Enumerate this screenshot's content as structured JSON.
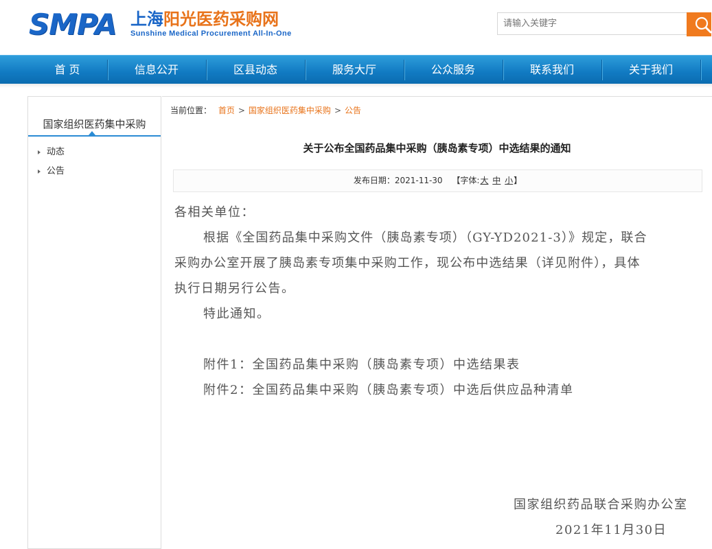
{
  "header": {
    "logo_abbr": "SMPA",
    "logo_cn_part1": "上海",
    "logo_cn_part2": "阳光医药采购网",
    "logo_en": "Sunshine Medical Procurement All-In-One",
    "search_placeholder": "请输入关键字",
    "search_icon": "search-icon"
  },
  "nav": {
    "items": [
      "首 页",
      "信息公开",
      "区县动态",
      "服务大厅",
      "公众服务",
      "联系我们",
      "关于我们"
    ]
  },
  "sidebar": {
    "title": "国家组织医药集中采购",
    "items": [
      "动态",
      "公告"
    ]
  },
  "breadcrumb": {
    "prefix": "当前位置：",
    "items": [
      "首页",
      "国家组织医药集中采购",
      "公告"
    ],
    "separator": ">"
  },
  "article": {
    "title": "关于公布全国药品集中采购（胰岛素专项）中选结果的通知",
    "publish_label": "发布日期：",
    "publish_date": "2021-11-30",
    "font_size_label_open": "【字体:",
    "font_size_large": "大",
    "font_size_medium": "中",
    "font_size_small": "小",
    "font_size_label_close": "】",
    "salutation": "各相关单位：",
    "para1_line1": "根据《全国药品集中采购文件（胰岛素专项）（GY-YD2021-3）》规定，联合",
    "para1_line2": "采购办公室开展了胰岛素专项集中采购工作，现公布中选结果（详见附件），具体",
    "para1_line3": "执行日期另行公告。",
    "para2": "特此通知。",
    "attachment1": "附件1：全国药品集中采购（胰岛素专项）中选结果表",
    "attachment2": "附件2：全国药品集中采购（胰岛素专项）中选后供应品种清单",
    "signature": "国家组织药品联合采购办公室",
    "sign_date": "2021年11月30日"
  },
  "colors": {
    "brand_blue": "#1a66c7",
    "brand_orange": "#e8731a",
    "nav_blue": "#117ac2",
    "search_button": "#f07a1e"
  }
}
